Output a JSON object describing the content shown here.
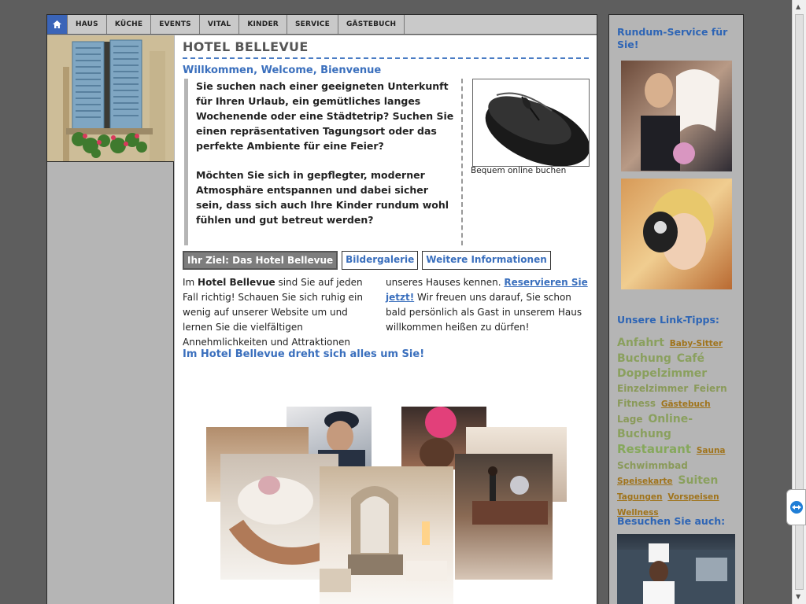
{
  "nav": {
    "home_icon": "home-icon",
    "items": [
      "HAUS",
      "KÜCHE",
      "EVENTS",
      "VITAL",
      "KINDER",
      "SERVICE",
      "GÄSTEBUCH"
    ]
  },
  "main": {
    "title": "HOTEL BELLEVUE",
    "subtitle": "Willkommen, Welcome, Bienvenue",
    "intro_p1": "Sie suchen nach einer geeigneten Unterkunft für Ihren Urlaub, ein gemütliches langes Wochenende oder eine Städtetrip? Suchen Sie einen repräsentativen Tagungsort oder das perfekte Ambiente für eine Feier?",
    "intro_p2": "Möchten Sie sich in gepflegter, moderner Atmosphäre entspannen und dabei sicher sein, dass sich auch Ihre Kinder rundum wohl fühlen und gut betreut werden?",
    "mouse_caption": "Bequem online buchen",
    "tabs": [
      "Ihr Ziel: Das Hotel Bellevue",
      "Bildergalerie",
      "Weitere Informationen"
    ],
    "body_pre": "Im ",
    "body_hotel": "Hotel Bellevue",
    "body_rest1": " sind Sie auf jeden Fall richtig! Schauen Sie sich ruhig ein wenig auf unserer Website um und lernen Sie die vielfältigen Annehmlichkeiten und Attraktionen",
    "body2_pre": "unseres Hauses kennen. ",
    "body2_link": "Reservieren Sie jetzt!",
    "body2_rest": " Wir freuen uns darauf, Sie schon bald persönlich als Gast in unserem Haus willkommen heißen zu dürfen!",
    "tagline": "Im Hotel Bellevue dreht sich alles um Sie!"
  },
  "sidebar": {
    "heading1": "Rundum-Service für Sie!",
    "heading2": "Unsere Link-Tipps:",
    "heading3": "Besuchen Sie auch:",
    "tags": [
      {
        "label": "Anfahrt",
        "size": 3
      },
      {
        "label": "Baby-Sitter",
        "size": 1
      },
      {
        "label": "Buchung",
        "size": 3
      },
      {
        "label": "Café",
        "size": 3
      },
      {
        "label": "Doppelzimmer",
        "size": 3
      },
      {
        "label": "Einzelzimmer",
        "size": 2
      },
      {
        "label": "Feiern",
        "size": 2
      },
      {
        "label": "Fitness",
        "size": 2
      },
      {
        "label": "Gästebuch",
        "size": 1
      },
      {
        "label": "Lage",
        "size": 2
      },
      {
        "label": "Online-Buchung",
        "size": 3
      },
      {
        "label": "Restaurant",
        "size": 4
      },
      {
        "label": "Sauna",
        "size": 1
      },
      {
        "label": "Schwimmbad",
        "size": 2
      },
      {
        "label": "Speisekarte",
        "size": 1
      },
      {
        "label": "Suiten",
        "size": 3
      },
      {
        "label": "Tagungen",
        "size": 1
      },
      {
        "label": "Vorspeisen",
        "size": 1
      },
      {
        "label": "Wellness",
        "size": 1
      }
    ]
  },
  "colors": {
    "accent": "#3a6fbd",
    "nav_home": "#3a64b8",
    "tag_link": "#8c7a2c"
  }
}
